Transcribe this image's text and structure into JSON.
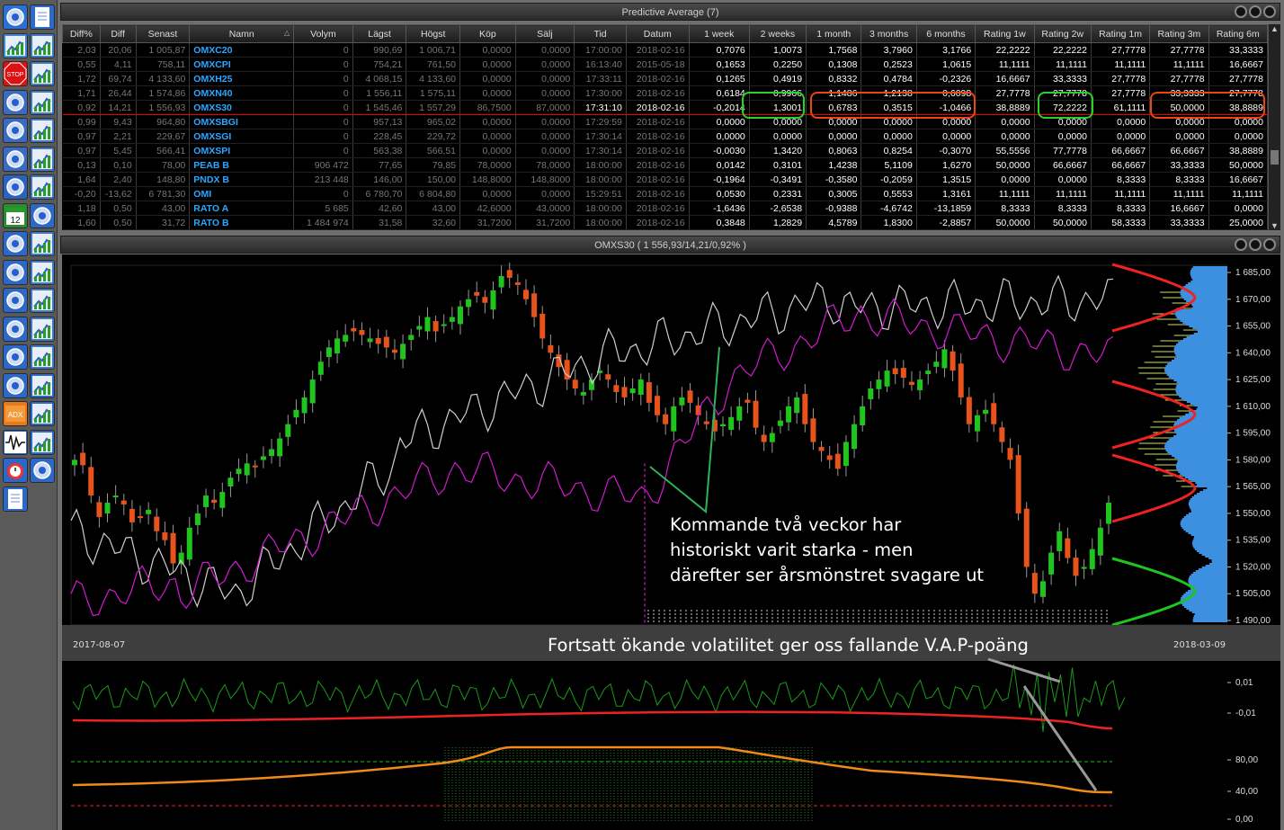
{
  "grid_panel": {
    "title": "Predictive Average (7)"
  },
  "chart_panel": {
    "title": "OMXS30 ( 1 556,93/14,21/0,92% )"
  },
  "columns": [
    "Diff%",
    "Diff",
    "Senast",
    "Namn",
    "Volym",
    "Lägst",
    "Högst",
    "Köp",
    "Sälj",
    "Tid",
    "Datum",
    "1 week",
    "2 weeks",
    "1 month",
    "3 months",
    "6 months",
    "Rating 1w",
    "Rating 2w",
    "Rating 1m",
    "Rating 3m",
    "Rating 6m"
  ],
  "rows": [
    [
      "2,03",
      "20,06",
      "1 005,87",
      "OMXC20",
      "0",
      "990,69",
      "1 006,71",
      "0,0000",
      "0,0000",
      "17:00:00",
      "2018-02-16",
      "0,7076",
      "1,0073",
      "1,7568",
      "3,7960",
      "3,1766",
      "22,2222",
      "22,2222",
      "27,7778",
      "27,7778",
      "33,3333"
    ],
    [
      "0,55",
      "4,11",
      "758,11",
      "OMXCPI",
      "0",
      "754,21",
      "761,50",
      "0,0000",
      "0,0000",
      "16:13:40",
      "2015-05-18",
      "0,1653",
      "0,2250",
      "0,1308",
      "0,2523",
      "1,0615",
      "11,1111",
      "11,1111",
      "11,1111",
      "11,1111",
      "16,6667"
    ],
    [
      "1,72",
      "69,74",
      "4 133,60",
      "OMXH25",
      "0",
      "4 068,15",
      "4 133,60",
      "0,0000",
      "0,0000",
      "17:33:11",
      "2018-02-16",
      "0,1265",
      "0,4919",
      "0,8332",
      "0,4784",
      "-0,2326",
      "16,6667",
      "33,3333",
      "27,7778",
      "27,7778",
      "27,7778"
    ],
    [
      "1,71",
      "26,44",
      "1 574,86",
      "OMXN40",
      "0",
      "1 556,11",
      "1 575,11",
      "0,0000",
      "0,0000",
      "17:30:00",
      "2018-02-16",
      "0,6184",
      "0,9966",
      "1,1486",
      "1,2138",
      "0,6098",
      "27,7778",
      "27,7778",
      "27,7778",
      "33,3333",
      "27,7778"
    ],
    [
      "0,92",
      "14,21",
      "1 556,93",
      "OMXS30",
      "0",
      "1 545,46",
      "1 557,29",
      "86,7500",
      "87,0000",
      "17:31:10",
      "2018-02-16",
      "-0,2014",
      "1,3001",
      "0,6783",
      "0,3515",
      "-1,0466",
      "38,8889",
      "72,2222",
      "61,1111",
      "50,0000",
      "38,8889"
    ],
    [
      "0,99",
      "9,43",
      "964,80",
      "OMXSBGI",
      "0",
      "957,13",
      "965,02",
      "0,0000",
      "0,0000",
      "17:29:59",
      "2018-02-16",
      "0,0000",
      "0,0000",
      "0,0000",
      "0,0000",
      "0,0000",
      "0,0000",
      "0,0000",
      "0,0000",
      "0,0000",
      "0,0000"
    ],
    [
      "0,97",
      "2,21",
      "229,67",
      "OMXSGI",
      "0",
      "228,45",
      "229,72",
      "0,0000",
      "0,0000",
      "17:30:14",
      "2018-02-16",
      "0,0000",
      "0,0000",
      "0,0000",
      "0,0000",
      "0,0000",
      "0,0000",
      "0,0000",
      "0,0000",
      "0,0000",
      "0,0000"
    ],
    [
      "0,97",
      "5,45",
      "566,41",
      "OMXSPI",
      "0",
      "563,38",
      "566,51",
      "0,0000",
      "0,0000",
      "17:30:14",
      "2018-02-16",
      "-0,0030",
      "1,3420",
      "0,8063",
      "0,8254",
      "-0,3070",
      "55,5556",
      "77,7778",
      "66,6667",
      "66,6667",
      "38,8889"
    ],
    [
      "0,13",
      "0,10",
      "78,00",
      "PEAB B",
      "906 472",
      "77,65",
      "79,85",
      "78,0000",
      "78,0000",
      "18:00:00",
      "2018-02-16",
      "0,0142",
      "0,3101",
      "1,4238",
      "5,1109",
      "1,6270",
      "50,0000",
      "66,6667",
      "66,6667",
      "33,3333",
      "50,0000"
    ],
    [
      "1,64",
      "2,40",
      "148,80",
      "PNDX B",
      "213 448",
      "146,00",
      "150,00",
      "148,8000",
      "148,8000",
      "18:00:00",
      "2018-02-16",
      "-0,1964",
      "-0,3491",
      "-0,3580",
      "-0,2059",
      "1,3515",
      "0,0000",
      "0,0000",
      "8,3333",
      "8,3333",
      "16,6667"
    ],
    [
      "-0,20",
      "-13,62",
      "6 781,30",
      "OMI",
      "0",
      "6 780,70",
      "6 804,80",
      "0,0000",
      "0,0000",
      "15:29:51",
      "2018-02-16",
      "0,0530",
      "0,2331",
      "0,3005",
      "0,5553",
      "1,3161",
      "11,1111",
      "11,1111",
      "11,1111",
      "11,1111",
      "11,1111"
    ],
    [
      "1,18",
      "0,50",
      "43,00",
      "RATO A",
      "5 685",
      "42,60",
      "43,00",
      "42,6000",
      "43,0000",
      "18:00:00",
      "2018-02-16",
      "-1,6436",
      "-2,6538",
      "-0,9388",
      "-4,6742",
      "-13,1859",
      "8,3333",
      "8,3333",
      "8,3333",
      "16,6667",
      "0,0000"
    ],
    [
      "1,60",
      "0,50",
      "31,72",
      "RATO B",
      "1 484 974",
      "31,58",
      "32,60",
      "31,7200",
      "31,7200",
      "18:00:00",
      "2018-02-16",
      "0,3848",
      "1,2829",
      "4,5789",
      "1,8300",
      "-2,8857",
      "50,0000",
      "50,0000",
      "58,3333",
      "33,3333",
      "25,0000"
    ]
  ],
  "selected_row": 4,
  "price_axis": [
    "1 685,00",
    "1 670,00",
    "1 655,00",
    "1 640,00",
    "1 625,00",
    "1 610,00",
    "1 595,00",
    "1 580,00",
    "1 565,00",
    "1 550,00",
    "1 535,00",
    "1 520,00",
    "1 505,00",
    "1 490,00"
  ],
  "date_start": "2017-08-07",
  "date_end": "2018-03-09",
  "annotation_main": "Kommande två veckor har\nhistoriskt varit starka - men\ndärefter ser årsmönstret svagare ut",
  "annotation_vol": "Fortsatt ökande volatilitet ger oss fallande V.A.P-poäng",
  "ind1_axis": [
    "0,01",
    "-0,01"
  ],
  "ind2_axis": [
    "80,00",
    "40,00",
    "0,00"
  ],
  "toolbar_icons": [
    "wrench-icon",
    "document-icon",
    "bar-chart-icon",
    "chart-v-icon",
    "stop-icon",
    "chart-ti-icon",
    "yinyang-icon",
    "chart-1-icon",
    "pin-icon",
    "chart-2-icon",
    "person-icon",
    "chart-b-icon",
    "swirl-icon",
    "chart-f-icon",
    "calendar-icon",
    "globe-icon",
    "compass-icon",
    "chart-m-icon",
    "network-icon",
    "chart-n-icon",
    "settings-icon",
    "chart-o-icon",
    "tools-icon",
    "chart-s-icon",
    "anchor-icon",
    "chart-d-icon",
    "trend-icon",
    "bars-up-icon",
    "adx-icon",
    "bars-up2-icon",
    "wave-icon",
    "bars-up3-icon",
    "alarm-icon",
    "filter-icon",
    "page-icon"
  ]
}
